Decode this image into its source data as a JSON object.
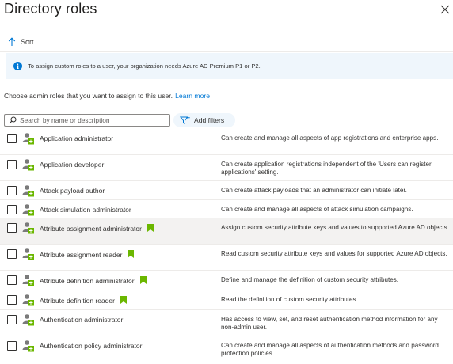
{
  "header": {
    "title": "Directory roles",
    "close_icon": "close-icon"
  },
  "toolbar": {
    "sort_label": "Sort",
    "sort_icon": "arrow-up-icon"
  },
  "banner": {
    "icon": "info-icon",
    "text": "To assign custom roles to a user, your organization needs Azure AD Premium P1 or P2."
  },
  "intro": {
    "text": "Choose admin roles that you want to assign to this user.",
    "link": "Learn more"
  },
  "search": {
    "placeholder": "Search by name or description",
    "value": ""
  },
  "filters": {
    "label": "Add filters"
  },
  "colors": {
    "accent": "#0078d4",
    "banner_bg": "#eff6fc",
    "flag": "#6bb700",
    "role_icon_green": "#6bb700"
  },
  "roles": [
    {
      "name": "Application administrator",
      "flag": false,
      "desc": "Can create and manage all aspects of app registrations and enterprise apps."
    },
    {
      "name": "Application developer",
      "flag": false,
      "desc": "Can create application registrations independent of the 'Users can register applications' setting."
    },
    {
      "name": "Attack payload author",
      "flag": false,
      "desc": "Can create attack payloads that an administrator can initiate later."
    },
    {
      "name": "Attack simulation administrator",
      "flag": false,
      "desc": "Can create and manage all aspects of attack simulation campaigns."
    },
    {
      "name": "Attribute assignment administrator",
      "flag": true,
      "desc": "Assign custom security attribute keys and values to supported Azure AD objects."
    },
    {
      "name": "Attribute assignment reader",
      "flag": true,
      "desc": "Read custom security attribute keys and values for supported Azure AD objects."
    },
    {
      "name": "Attribute definition administrator",
      "flag": true,
      "desc": "Define and manage the definition of custom security attributes."
    },
    {
      "name": "Attribute definition reader",
      "flag": true,
      "desc": "Read the definition of custom security attributes."
    },
    {
      "name": "Authentication administrator",
      "flag": false,
      "desc": "Has access to view, set, and reset authentication method information for any non-admin user."
    },
    {
      "name": "Authentication policy administrator",
      "flag": false,
      "desc": "Can create and manage all aspects of authentication methods and password protection policies."
    }
  ]
}
